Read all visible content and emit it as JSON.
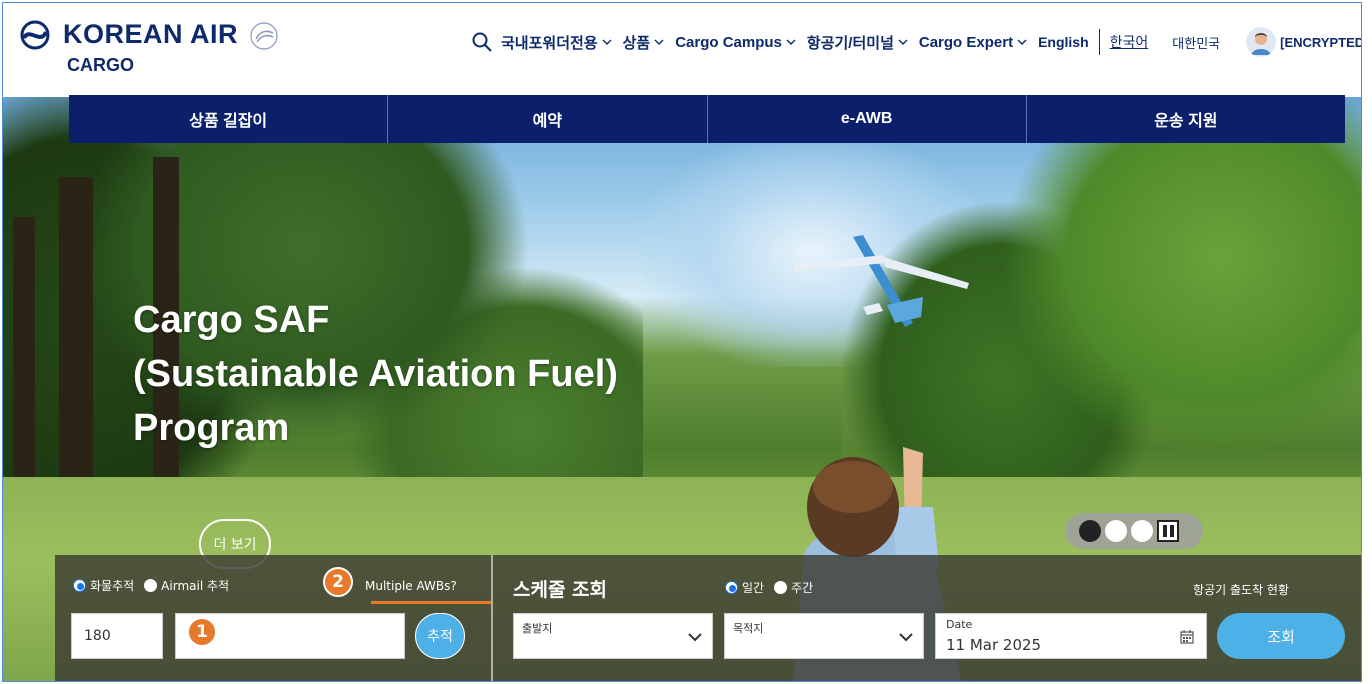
{
  "brand": {
    "name": "KOREAN AIR",
    "division": "CARGO"
  },
  "topnav": {
    "items": [
      {
        "label": "국내포워더전용"
      },
      {
        "label": "상품"
      },
      {
        "label": "Cargo Campus"
      },
      {
        "label": "항공기/터미널"
      },
      {
        "label": "Cargo Expert"
      }
    ],
    "lang_en": "English",
    "lang_ko": "한국어",
    "country": "대한민국",
    "user": "[ENCRYPTED"
  },
  "service_menu": [
    {
      "label": "상품 길잡이"
    },
    {
      "label": "예약"
    },
    {
      "label": "e-AWB"
    },
    {
      "label": "운송 지원"
    }
  ],
  "hero": {
    "title_lines": [
      "Cargo SAF",
      "(Sustainable Aviation Fuel)",
      "Program"
    ],
    "more_button": "더 보기",
    "carousel": {
      "slides": 3,
      "active": 0
    }
  },
  "tracking": {
    "radio_cargo": "화물추적",
    "radio_airmail": "Airmail 추적",
    "selected": "cargo",
    "multiple_awbs": "Multiple AWBs?",
    "prefix_value": "180",
    "awb_value": "",
    "track_button": "추적",
    "badges": [
      "1",
      "2"
    ]
  },
  "schedule": {
    "title": "스케줄 조회",
    "radio_daily": "일간",
    "radio_weekly": "주간",
    "selected": "daily",
    "flight_status_link": "항공기 출도착 현황",
    "origin_label": "출발지",
    "destination_label": "목적지",
    "date_label": "Date",
    "date_value": "11 Mar 2025",
    "search_button": "조회"
  }
}
